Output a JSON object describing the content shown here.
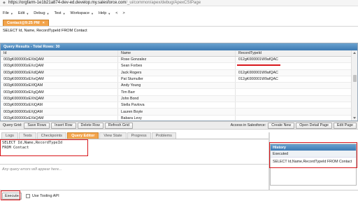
{
  "browser": {
    "url_host": "https://orgfarm-1e1b21a874-dev-ed.develop.my.salesforce.com",
    "url_path": "/_ui/common/apex/debug/ApexCSIPage"
  },
  "menubar": {
    "items": [
      "File",
      "Edit",
      "Debug",
      "Test",
      "Workspace",
      "Help",
      "<",
      ">"
    ]
  },
  "file_tab": {
    "label": "Contact@9:25 PM",
    "close": "×"
  },
  "query_text": "SELECT Id, Name, RecordTypeId FROM Contact",
  "results": {
    "header": "Query Results - Total Rows: 30",
    "columns": [
      "Id",
      "Name",
      "RecordTypeId"
    ],
    "rows": [
      [
        "003gK000000zEXbQAM",
        "Rose Gonzalez",
        "012gK000001W9afQAC"
      ],
      [
        "003gK000000zEXcQAM",
        "Sean Forbes",
        ""
      ],
      [
        "003gK000000zEXdQAM",
        "Jack Rogers",
        "012gK000001W9afQAC"
      ],
      [
        "003gK000000zEXeQAM",
        "Pat Stumuller",
        "012gK000001W9afQAC"
      ],
      [
        "003gK000000zEXfQAM",
        "Andy Young",
        ""
      ],
      [
        "003gK000000zEXgQAM",
        "Tim Barr",
        ""
      ],
      [
        "003gK000000zEXhQAM",
        "John Bond",
        ""
      ],
      [
        "003gK000000zEXiQAM",
        "Stella Pavlova",
        ""
      ],
      [
        "003gK000000zEXjQAM",
        "Lauren Boyle",
        ""
      ],
      [
        "003gK000000zEXkQAM",
        "Babara Levy",
        ""
      ]
    ]
  },
  "toolbar": {
    "grid_label": "Query Grid:",
    "save_rows": "Save Rows",
    "insert_row": "Insert Row",
    "delete_row": "Delete Row",
    "refresh_grid": "Refresh Grid",
    "access_label": "Access in Salesforce:",
    "create_new": "Create New",
    "open_detail": "Open Detail Page",
    "edit_page": "Edit Page"
  },
  "lower_tabs": [
    "Logs",
    "Tests",
    "Checkpoints",
    "Query Editor",
    "View State",
    "Progress",
    "Problems"
  ],
  "lower_active_tab": "Query Editor",
  "editor": {
    "line1": "SELECT Id,Name,RecordTypeId",
    "line2": "FROM Contact"
  },
  "errors_placeholder": "Any query errors will appear here...",
  "bottom": {
    "execute": "Execute",
    "tooling_api": "Use Tooling API"
  },
  "history": {
    "title": "History",
    "column": "Executed",
    "rows": [
      "SELECT Id,Name,RecordTypeId FROM Contact"
    ]
  },
  "colors": {
    "accent_orange": "#f3a44b",
    "header_blue": "#3d7ab3",
    "highlight_red": "#d8161b"
  }
}
